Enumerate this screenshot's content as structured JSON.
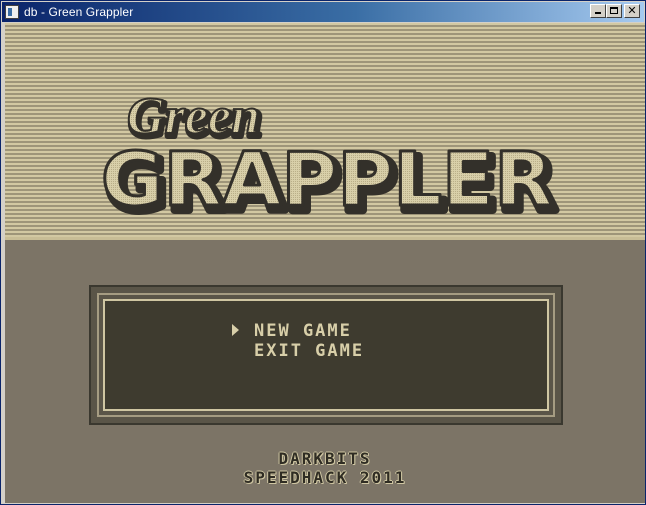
{
  "window": {
    "title": "db - Green Grappler",
    "icon": "app-icon",
    "buttons": {
      "minimize": "minimize-icon",
      "maximize": "maximize-icon",
      "close": "close-icon"
    }
  },
  "logo": {
    "top_word": "Green",
    "main_word": "GRAPPLER"
  },
  "menu": {
    "items": [
      {
        "label": "NEW GAME",
        "selected": true
      },
      {
        "label": "EXIT GAME",
        "selected": false
      }
    ]
  },
  "credits": {
    "line1": "DARKBITS",
    "line2": "SPEEDHACK 2011"
  },
  "colors": {
    "background": "#7c7466",
    "stripe_light": "#d2c8a2",
    "stripe_dark": "#9e9579",
    "logo_fill": "#d8cfa9",
    "logo_outline": "#33302a",
    "menu_text": "#d8cfa9",
    "menu_panel": "#3e3b2f"
  }
}
